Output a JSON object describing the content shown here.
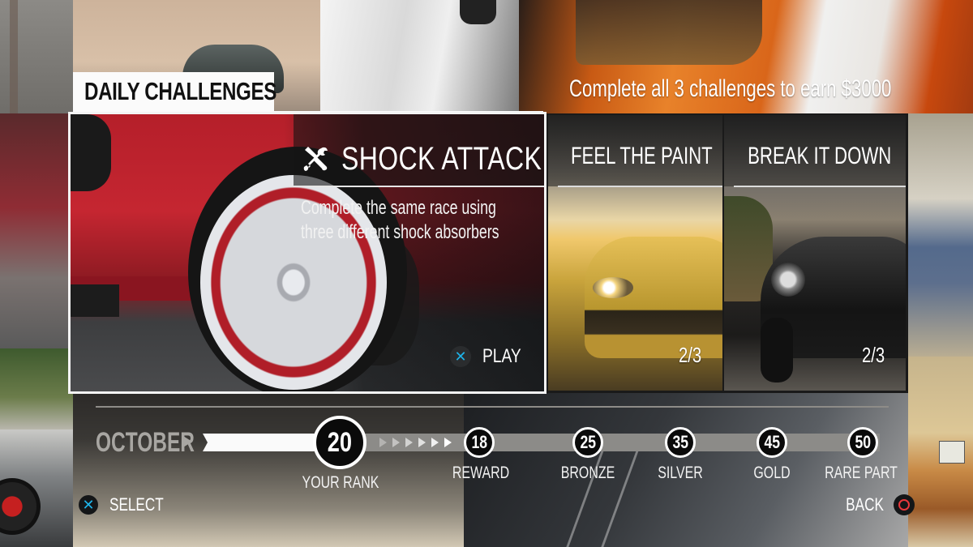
{
  "header": {
    "title": "DAILY CHALLENGES",
    "reward_text": "Complete all 3 challenges to earn $3000"
  },
  "featured": {
    "icon": "wrench-screwdriver-icon",
    "title": "SHOCK ATTACK",
    "description_line1": "Complete the same race using",
    "description_line2": "three different shock absorbers",
    "play_label": "PLAY",
    "play_button_glyph": "✕"
  },
  "challenges": [
    {
      "title": "FEEL THE PAINT",
      "progress": "2/3",
      "completed": 2,
      "total": 3
    },
    {
      "title": "BREAK IT DOWN",
      "progress": "2/3",
      "completed": 2,
      "total": 3
    }
  ],
  "progress": {
    "month": "OCTOBER",
    "your_rank": {
      "value": "20",
      "label": "YOUR RANK"
    },
    "milestones": [
      {
        "value": "18",
        "label": "REWARD"
      },
      {
        "value": "25",
        "label": "BRONZE"
      },
      {
        "value": "35",
        "label": "SILVER"
      },
      {
        "value": "45",
        "label": "GOLD"
      },
      {
        "value": "50",
        "label": "RARE PART"
      }
    ]
  },
  "footer": {
    "select_label": "SELECT",
    "select_glyph": "✕",
    "back_label": "BACK"
  },
  "colors": {
    "cross_button": "#1eb4ea",
    "circle_button": "#e8383c",
    "panel_border": "#f4f4f4",
    "month_text": "#a8a6a2"
  }
}
